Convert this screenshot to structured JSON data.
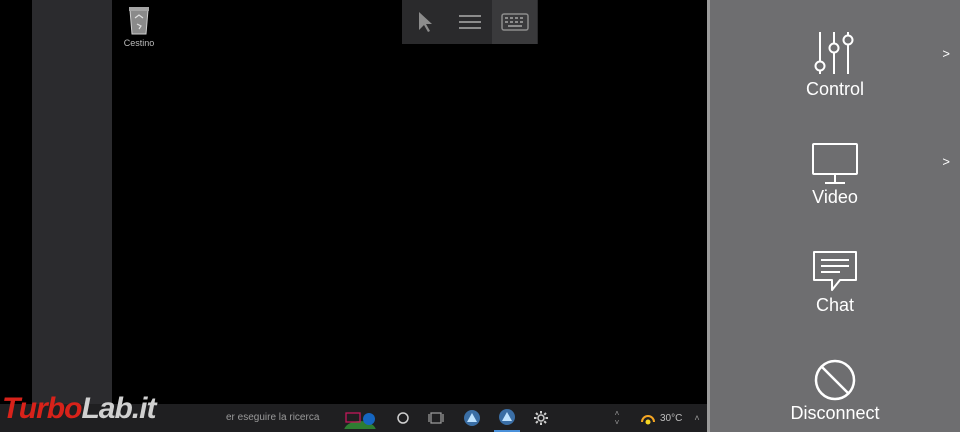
{
  "desktop": {
    "recycle_bin_label": "Cestino",
    "search_text": "er eseguire la ricerca",
    "temperature": "30°C"
  },
  "watermark": {
    "part1": "Turbo",
    "part2": "Lab.it"
  },
  "side_menu": {
    "items": [
      {
        "label": "Control",
        "icon": "sliders-icon",
        "has_submenu": true,
        "submenu_glyph": ">"
      },
      {
        "label": "Video",
        "icon": "monitor-icon",
        "has_submenu": true,
        "submenu_glyph": ">"
      },
      {
        "label": "Chat",
        "icon": "chat-icon",
        "has_submenu": false
      },
      {
        "label": "Disconnect",
        "icon": "disconnect-icon",
        "has_submenu": false
      }
    ]
  },
  "colors": {
    "panel_bg": "#6e6e70",
    "desktop_bg": "#000000",
    "logo_red": "#d8221a"
  }
}
